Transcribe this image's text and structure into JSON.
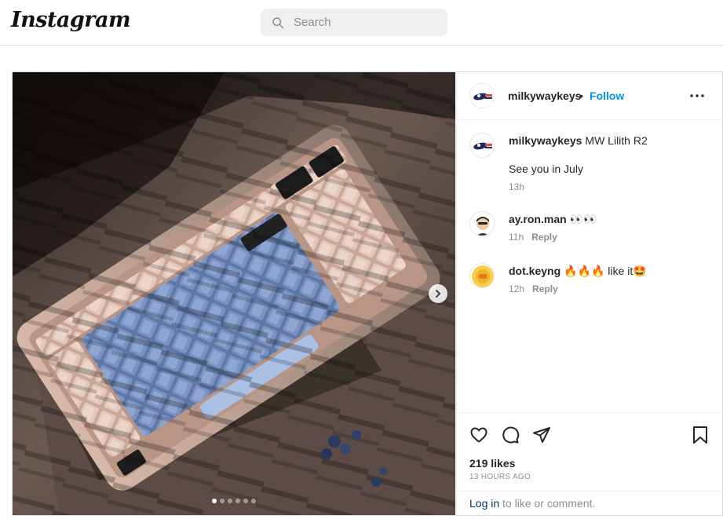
{
  "nav": {
    "logo": "Instagram",
    "search_placeholder": "Search"
  },
  "post": {
    "username": "milkywaykeys",
    "separator": "•",
    "follow_label": "Follow",
    "caption_title": "MW Lilith R2",
    "caption_line2": "See you in July",
    "caption_time": "13h",
    "carousel": {
      "count": 6,
      "active_index": 0
    },
    "comments": [
      {
        "user": "ay.ron.man",
        "text": "👀👀",
        "time": "11h",
        "reply": "Reply"
      },
      {
        "user": "dot.keyng",
        "text": "🔥🔥🔥 like it🤩",
        "time": "12h",
        "reply": "Reply"
      }
    ],
    "likes": "219 likes",
    "timestamp": "13 HOURS AGO",
    "login_link": "Log in",
    "login_rest": " to like or comment."
  },
  "icons": {
    "search": "search-icon",
    "more": "more-options-icon",
    "next": "chevron-right-icon",
    "like": "heart-icon",
    "comment": "comment-icon",
    "share": "share-icon",
    "save": "bookmark-icon"
  },
  "colors": {
    "accent": "#0095f6",
    "link": "#00376b",
    "muted": "#8e8e8e"
  }
}
